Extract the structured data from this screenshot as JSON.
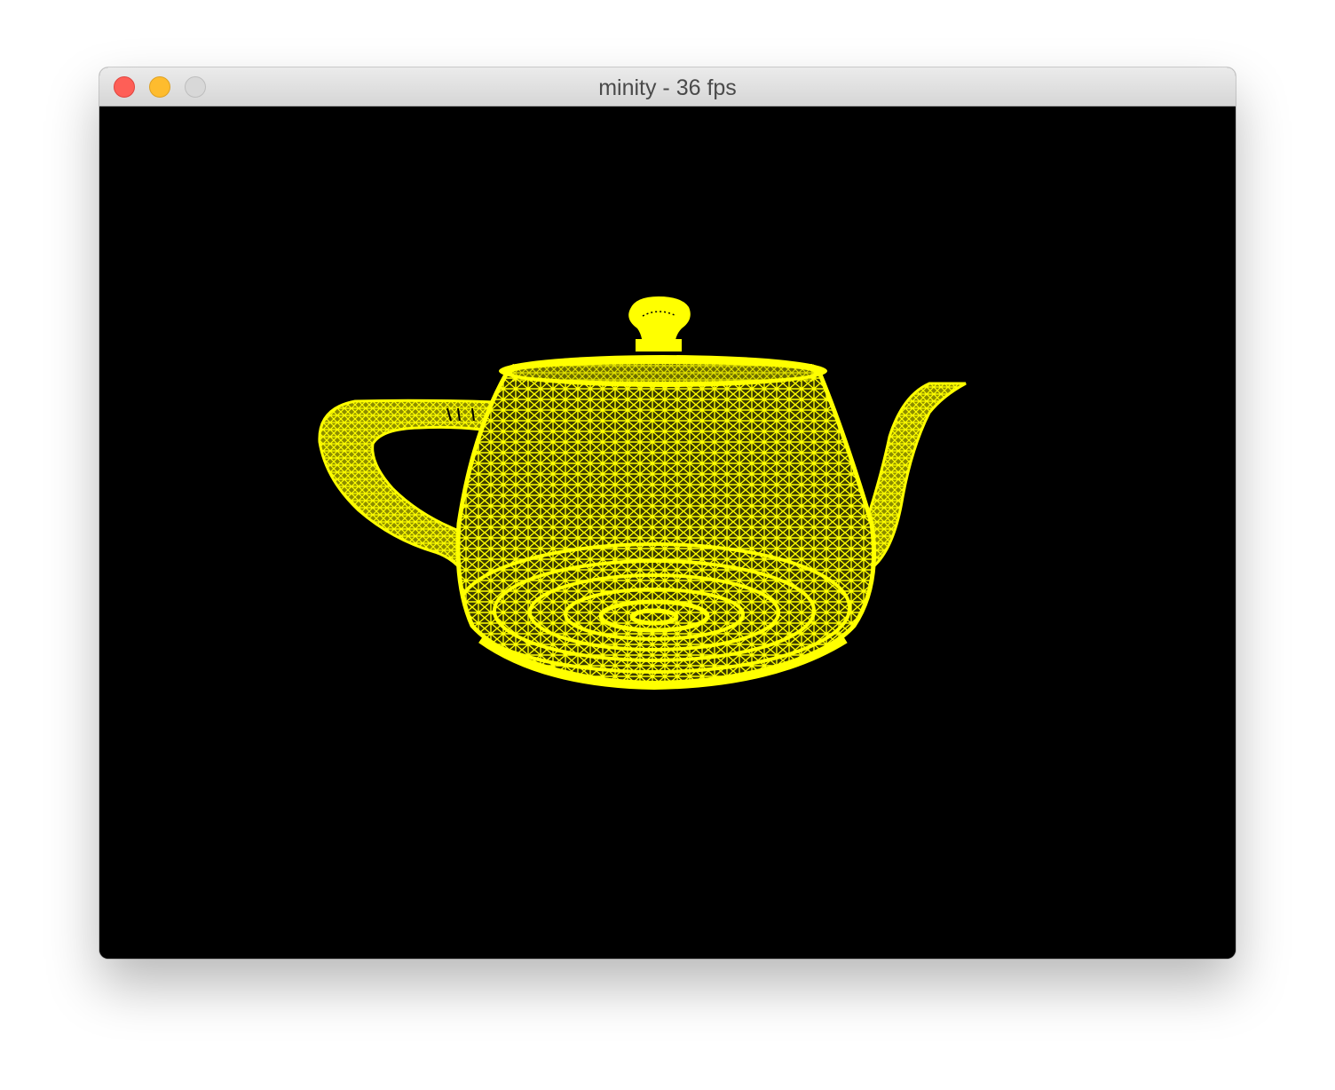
{
  "window": {
    "title": "minity - 36 fps"
  },
  "traffic_lights": {
    "close": "close-button",
    "minimize": "minimize-button",
    "zoom": "zoom-button"
  },
  "viewport": {
    "background": "#000000",
    "model": "teapot",
    "render_mode": "wireframe",
    "wire_color": "#ffff00"
  }
}
